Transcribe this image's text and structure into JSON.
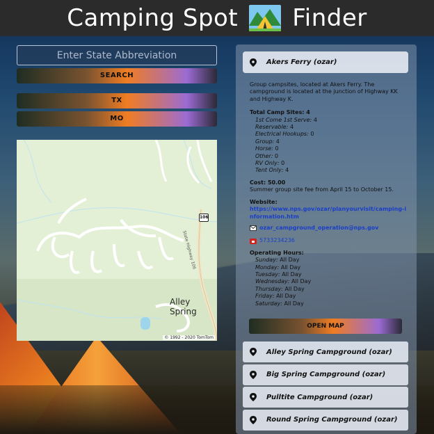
{
  "header": {
    "title_left": "Camping Spot",
    "title_right": "Finder",
    "icon": "tent-emoji-icon"
  },
  "search": {
    "placeholder": "Enter State Abbreviation",
    "button_label": "SEARCH"
  },
  "states": [
    "TX",
    "MO"
  ],
  "map": {
    "place_label": "Alley Spring",
    "road_label": "State Highway 106",
    "shield_label": "106",
    "copyright": "© 1992 - 2020 TomTom"
  },
  "selected": {
    "name": "Akers Ferry (ozar)",
    "description": "Group campsites, located at Akers Ferry. The campground is located at the junction of Highway KK and Highway K.",
    "total_sites_label": "Total Camp Sites: 4",
    "sites": [
      {
        "label": "1st Come 1st Serve:",
        "value": "4"
      },
      {
        "label": "Reservable:",
        "value": "4"
      },
      {
        "label": "Electrical Hookups:",
        "value": "0"
      },
      {
        "label": "Group:",
        "value": "4"
      },
      {
        "label": "Horse:",
        "value": "0"
      },
      {
        "label": "Other:",
        "value": "0"
      },
      {
        "label": "RV Only:",
        "value": "0"
      },
      {
        "label": "Tent Only:",
        "value": "4"
      }
    ],
    "cost_label": "Cost: 50.00",
    "cost_note": "Summer group site fee from April 15 to October 15.",
    "website_label": "Website:",
    "website_url": "https://www.nps.gov/ozar/planyourvisit/camping-information.htm",
    "email": "ozar_campground_operation@nps.gov",
    "phone": "5733234236",
    "hours_label": "Operating Hours:",
    "hours": [
      {
        "day": "Sunday:",
        "value": "All Day"
      },
      {
        "day": "Monday:",
        "value": "All Day"
      },
      {
        "day": "Tuesday:",
        "value": "All Day"
      },
      {
        "day": "Wednesday:",
        "value": "All Day"
      },
      {
        "day": "Thursday:",
        "value": "All Day"
      },
      {
        "day": "Friday:",
        "value": "All Day"
      },
      {
        "day": "Saturday:",
        "value": "All Day"
      }
    ],
    "open_map_label": "OPEN MAP"
  },
  "campgrounds": [
    "Alley Spring Campground (ozar)",
    "Big Spring Campground (ozar)",
    "Pulltite Campground (ozar)",
    "Round Spring Campground (ozar)"
  ]
}
